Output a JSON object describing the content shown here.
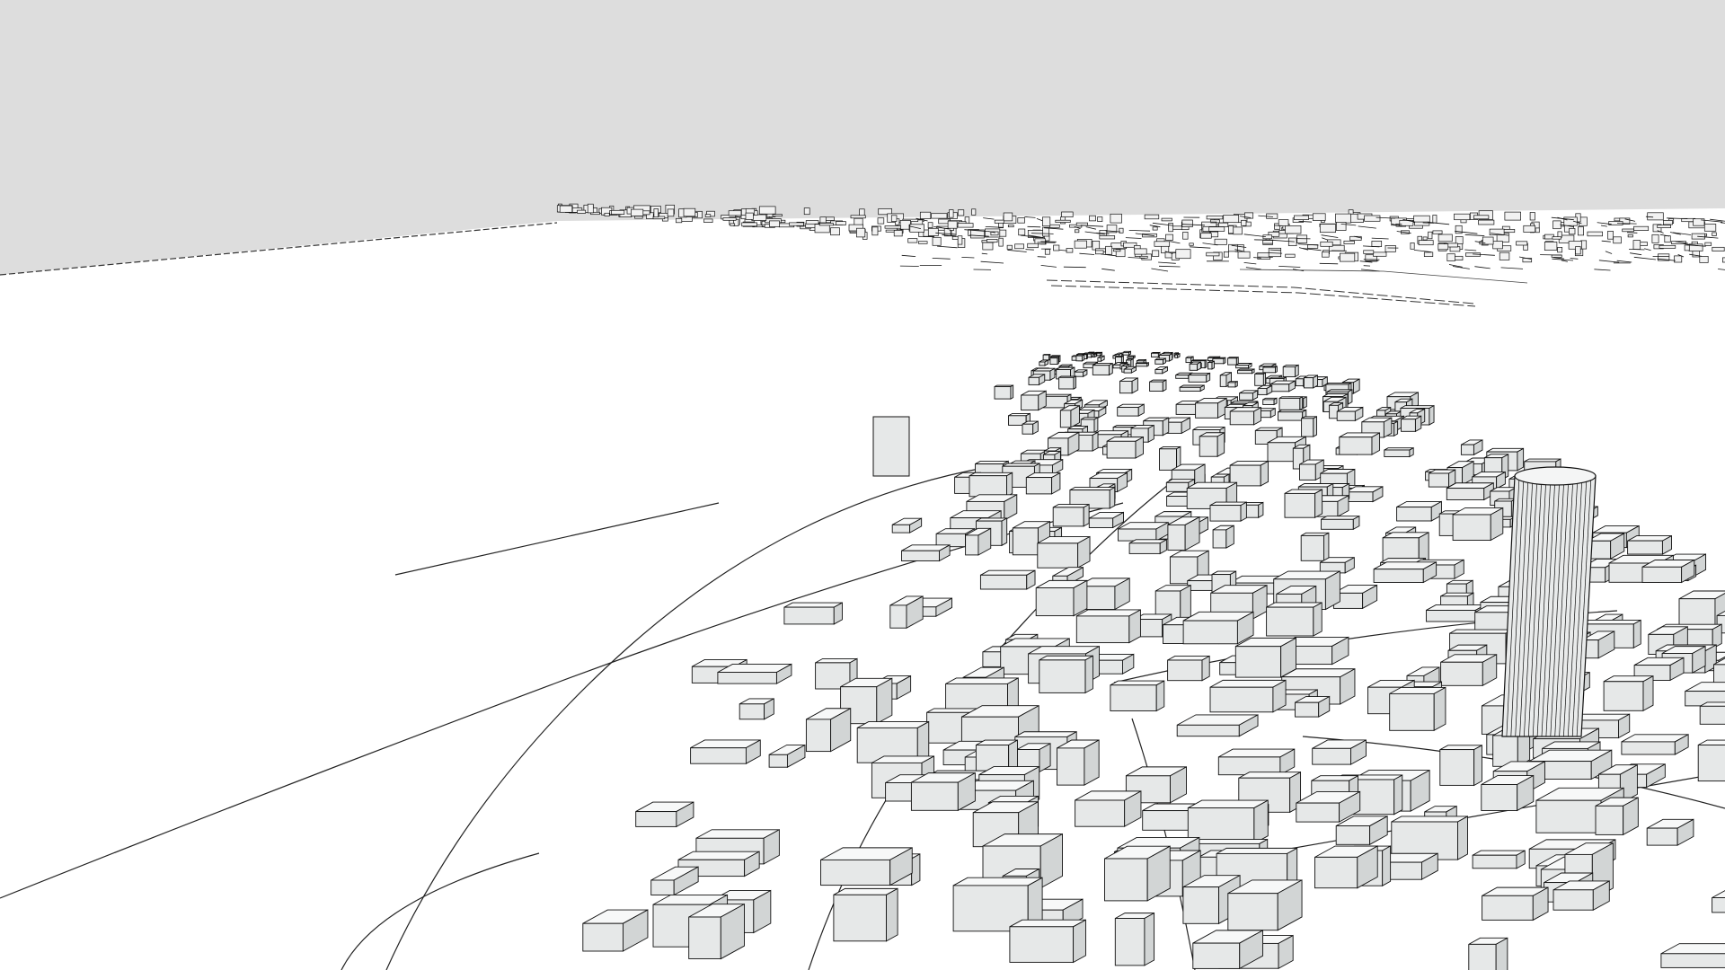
{
  "scene": {
    "view": "3d-model-viewport",
    "style": "monochrome-massing",
    "sky_color": "#dddddd",
    "ground_color": "#ffffff",
    "face_light_color": "#f7f8f8",
    "face_mid_color": "#e6e8e8",
    "face_dark_color": "#d2d5d5",
    "edge_color": "#111111",
    "contents": [
      "building-blocks",
      "road-outlines",
      "distant-skyline",
      "tower-icon"
    ]
  }
}
